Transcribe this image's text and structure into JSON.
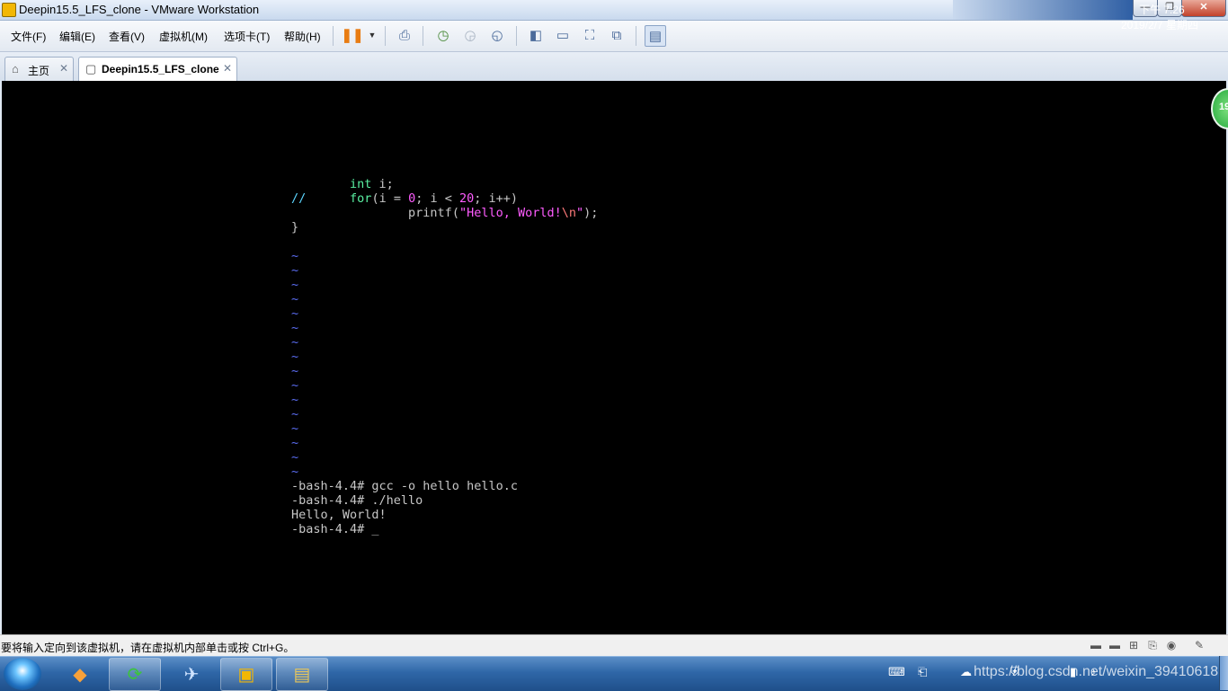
{
  "window": {
    "title": "Deepin15.5_LFS_clone - VMware Workstation",
    "min_glyph": "—",
    "max_glyph": "❐",
    "close_glyph": "✕"
  },
  "menubar": {
    "items": [
      {
        "label": "文件(F)"
      },
      {
        "label": "编辑(E)"
      },
      {
        "label": "查看(V)"
      },
      {
        "label": "虚拟机(M)"
      },
      {
        "label": "选项卡(T)"
      },
      {
        "label": "帮助(H)"
      }
    ],
    "toolbar_icons": [
      "pause-icon",
      "dropdown-arrow-icon",
      "send-keys-icon",
      "snapshot-take-icon",
      "snapshot-revert-icon",
      "snapshot-manager-icon",
      "console-view-icon",
      "fullscreen-bar-icon",
      "fit-window-icon",
      "unity-icon",
      "library-view-icon"
    ]
  },
  "tabs": [
    {
      "label": "主页",
      "icon": "home-icon",
      "close": "✕"
    },
    {
      "label": "Deepin15.5_LFS_clone",
      "icon": "vm-icon",
      "close": "✕"
    }
  ],
  "terminal": {
    "lines": [
      {
        "indent": "        ",
        "parts": [
          {
            "t": "int",
            "c": "kw"
          },
          {
            "t": " i;",
            "c": ""
          }
        ]
      },
      {
        "indent": "",
        "parts": [
          {
            "t": "//",
            "c": "cmt"
          },
          {
            "t": "      ",
            "c": ""
          },
          {
            "t": "for",
            "c": "kw"
          },
          {
            "t": "(i = ",
            "c": ""
          },
          {
            "t": "0",
            "c": "num"
          },
          {
            "t": "; i < ",
            "c": ""
          },
          {
            "t": "20",
            "c": "num"
          },
          {
            "t": "; i++)",
            "c": ""
          }
        ]
      },
      {
        "indent": "                ",
        "parts": [
          {
            "t": "printf(",
            "c": ""
          },
          {
            "t": "\"Hello, World!",
            "c": "str"
          },
          {
            "t": "\\n",
            "c": "esc"
          },
          {
            "t": "\"",
            "c": "str"
          },
          {
            "t": ");",
            "c": ""
          }
        ]
      },
      {
        "indent": "",
        "parts": [
          {
            "t": "}",
            "c": ""
          }
        ]
      },
      {
        "indent": "",
        "parts": [
          {
            "t": "",
            "c": ""
          }
        ]
      },
      {
        "indent": "",
        "parts": [
          {
            "t": "~",
            "c": "tilde"
          }
        ]
      },
      {
        "indent": "",
        "parts": [
          {
            "t": "~",
            "c": "tilde"
          }
        ]
      },
      {
        "indent": "",
        "parts": [
          {
            "t": "~",
            "c": "tilde"
          }
        ]
      },
      {
        "indent": "",
        "parts": [
          {
            "t": "~",
            "c": "tilde"
          }
        ]
      },
      {
        "indent": "",
        "parts": [
          {
            "t": "~",
            "c": "tilde"
          }
        ]
      },
      {
        "indent": "",
        "parts": [
          {
            "t": "~",
            "c": "tilde"
          }
        ]
      },
      {
        "indent": "",
        "parts": [
          {
            "t": "~",
            "c": "tilde"
          }
        ]
      },
      {
        "indent": "",
        "parts": [
          {
            "t": "~",
            "c": "tilde"
          }
        ]
      },
      {
        "indent": "",
        "parts": [
          {
            "t": "~",
            "c": "tilde"
          }
        ]
      },
      {
        "indent": "",
        "parts": [
          {
            "t": "~",
            "c": "tilde"
          }
        ]
      },
      {
        "indent": "",
        "parts": [
          {
            "t": "~",
            "c": "tilde"
          }
        ]
      },
      {
        "indent": "",
        "parts": [
          {
            "t": "~",
            "c": "tilde"
          }
        ]
      },
      {
        "indent": "",
        "parts": [
          {
            "t": "~",
            "c": "tilde"
          }
        ]
      },
      {
        "indent": "",
        "parts": [
          {
            "t": "~",
            "c": "tilde"
          }
        ]
      },
      {
        "indent": "",
        "parts": [
          {
            "t": "~",
            "c": "tilde"
          }
        ]
      },
      {
        "indent": "",
        "parts": [
          {
            "t": "~",
            "c": "tilde"
          }
        ]
      },
      {
        "indent": "",
        "parts": [
          {
            "t": "-bash-4.4# gcc -o hello hello.c",
            "c": ""
          }
        ]
      },
      {
        "indent": "",
        "parts": [
          {
            "t": "-bash-4.4# ./hello",
            "c": ""
          }
        ]
      },
      {
        "indent": "",
        "parts": [
          {
            "t": "Hello, World!",
            "c": ""
          }
        ]
      },
      {
        "indent": "",
        "parts": [
          {
            "t": "-bash-4.4# ",
            "c": ""
          },
          {
            "t": "_",
            "c": "cursor"
          }
        ]
      }
    ]
  },
  "badge": {
    "text": "19"
  },
  "statusbar": {
    "message": "要将输入定向到该虚拟机，请在虚拟机内部单击或按 Ctrl+G。",
    "icons": [
      "hdd-icon",
      "hdd2-icon",
      "network-icon",
      "usb-icon",
      "sound-icon",
      "printer-icon",
      "message-icon"
    ]
  },
  "taskbar": {
    "apps": [
      {
        "name": "browser-icon",
        "glyph": "◆",
        "color": "#f7a13a"
      },
      {
        "name": "refresh-app-icon",
        "glyph": "⟳",
        "color": "#3cc43c"
      },
      {
        "name": "bird-app-icon",
        "glyph": "✈",
        "color": "#3f8be0"
      },
      {
        "name": "vmware-icon",
        "glyph": "▣",
        "color": "#f2b705"
      },
      {
        "name": "folder-icon",
        "glyph": "▤",
        "color": "#e8c65a"
      }
    ],
    "tray_icons": [
      "keyboard-icon",
      "devices-icon",
      "cloud-icon",
      "ie-icon",
      "security-icon",
      "network-tray-icon",
      "volume-icon"
    ],
    "time": "下午 7:26",
    "date": "2019/2/7 星期四",
    "watermark": "https://blog.csdn.net/weixin_39410618"
  }
}
